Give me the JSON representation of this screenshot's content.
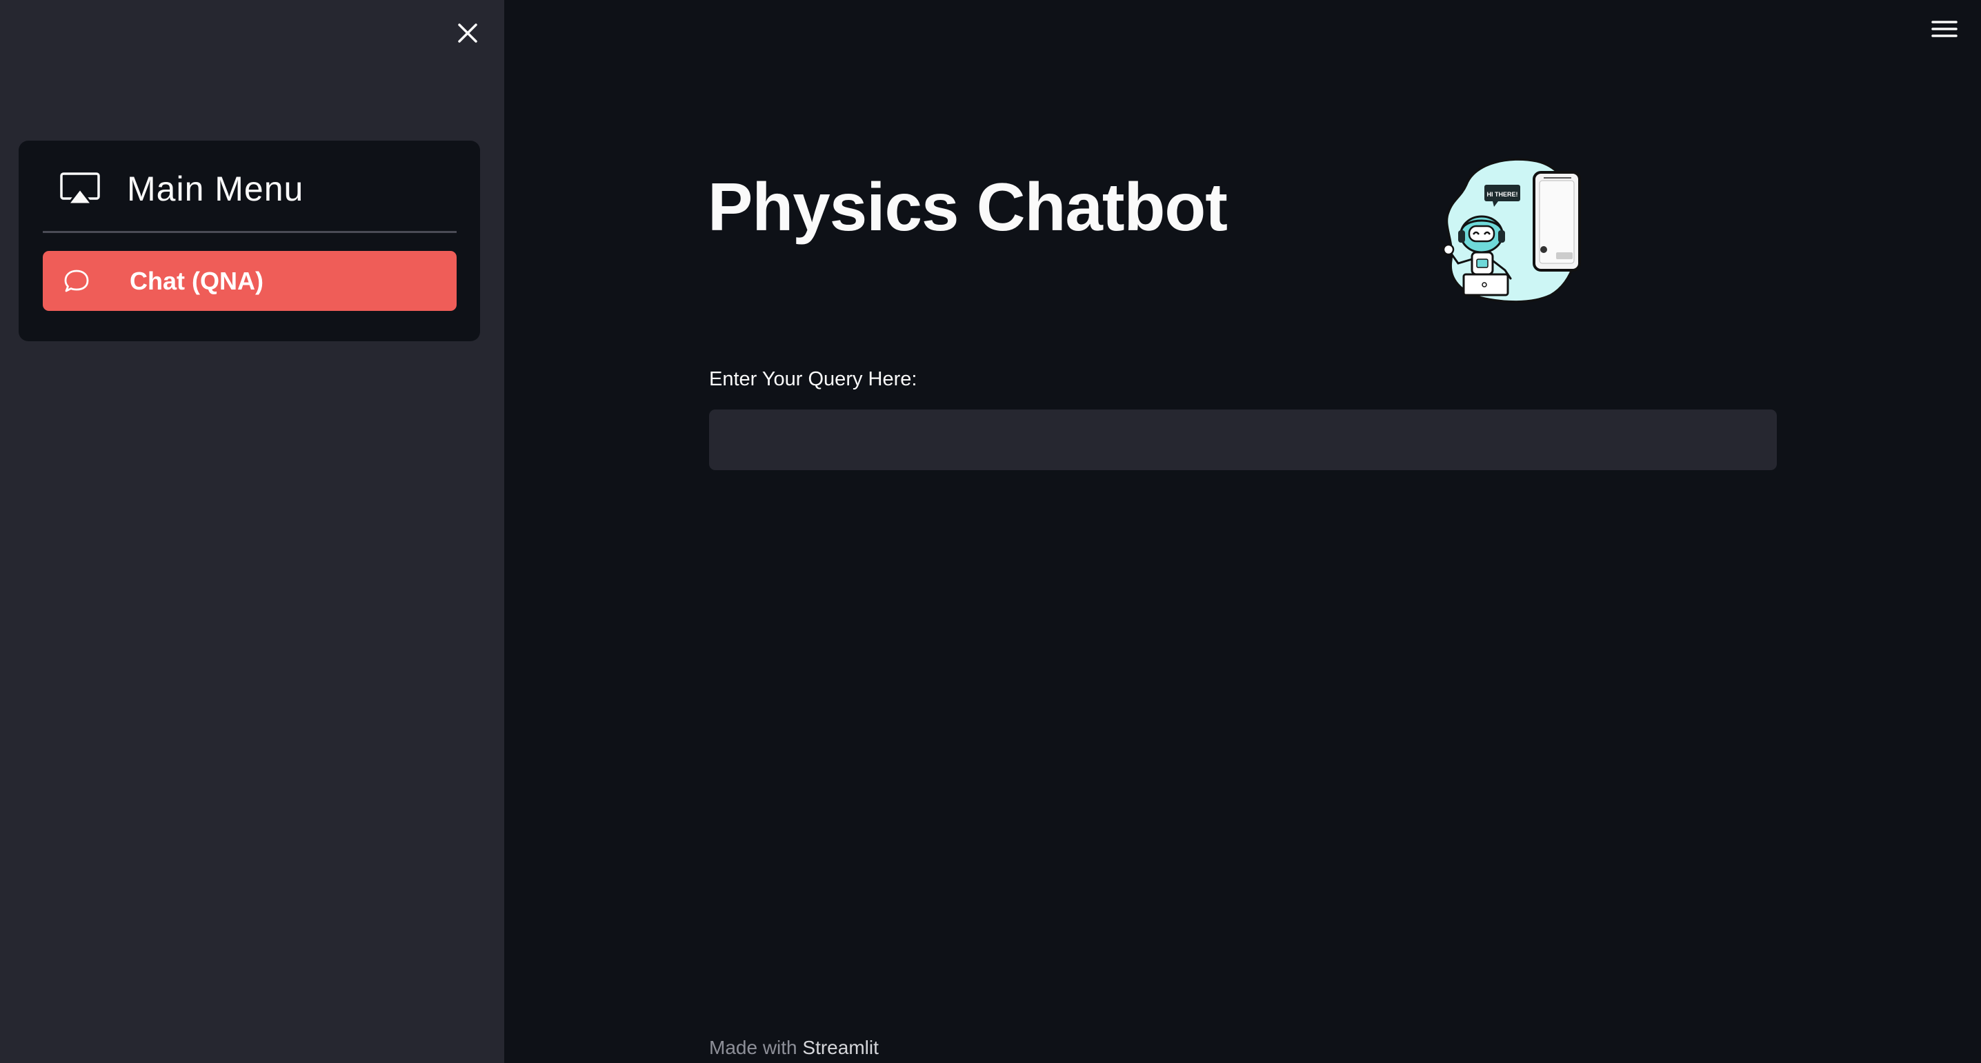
{
  "sidebar": {
    "menu_title": "Main Menu",
    "menu_icon": "cast-icon",
    "items": [
      {
        "label": "Chat (QNA)",
        "icon": "chat-icon",
        "active": true
      }
    ],
    "close_icon": "close-icon"
  },
  "header": {
    "menu_icon": "hamburger-icon"
  },
  "main": {
    "title": "Physics Chatbot",
    "illustration": "robot-chat-illustration",
    "input_label": "Enter Your Query Here:",
    "input_value": "",
    "input_placeholder": ""
  },
  "footer": {
    "prefix": "Made with",
    "link": "Streamlit"
  },
  "colors": {
    "background": "#0e1117",
    "sidebar": "#262730",
    "accent": "#ef5d58",
    "text": "#fafafa"
  }
}
